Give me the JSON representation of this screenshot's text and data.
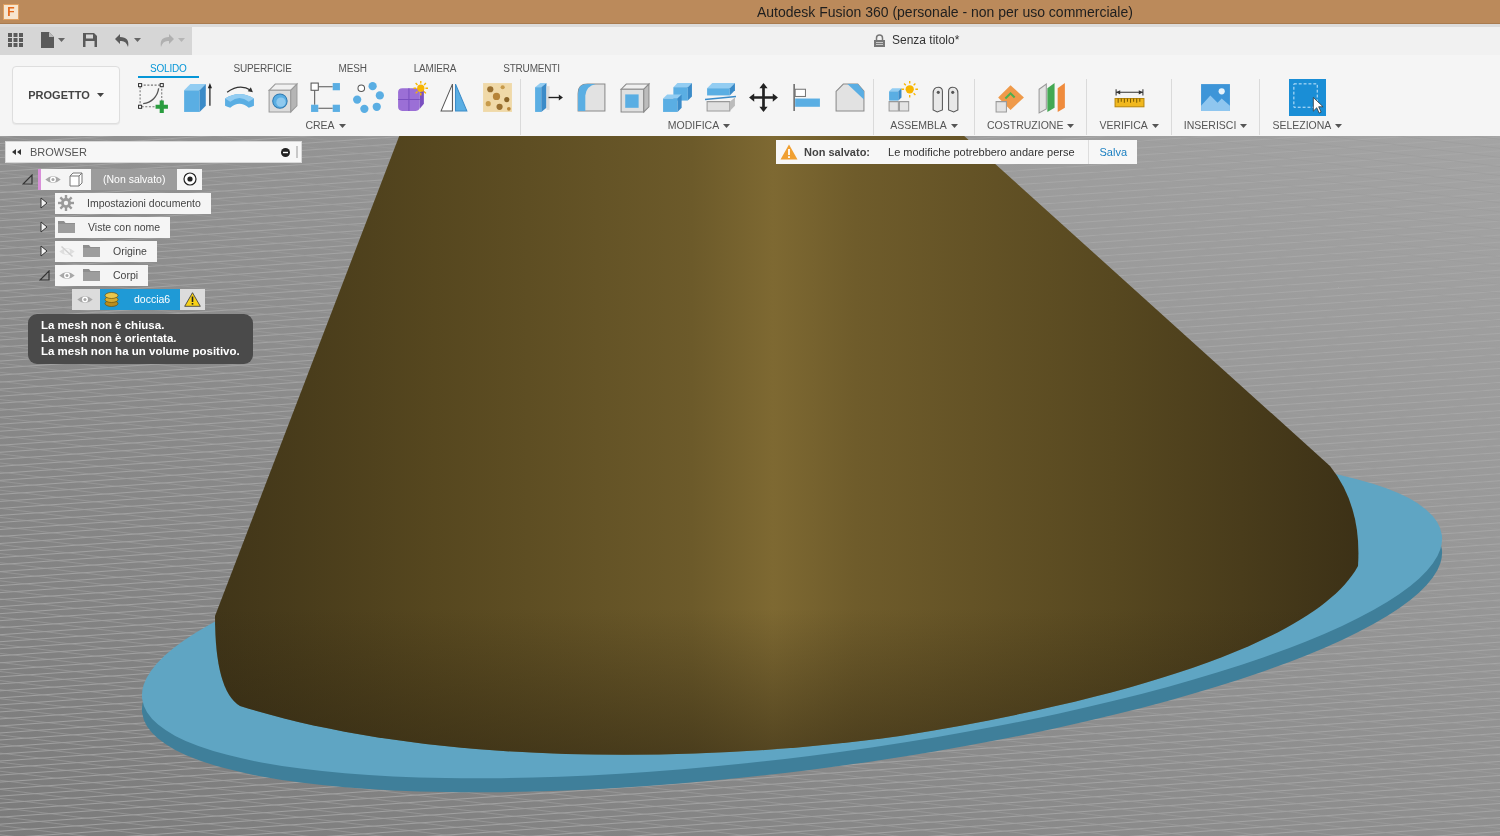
{
  "window": {
    "logo": "F",
    "title": "Autodesk Fusion 360 (personale - non per uso commerciale)"
  },
  "quick_access": [
    {
      "kind": "apps",
      "disabled": false
    },
    {
      "kind": "file",
      "disabled": false
    },
    {
      "kind": "save",
      "disabled": false
    },
    {
      "kind": "undo",
      "disabled": false
    },
    {
      "kind": "redo",
      "disabled": true
    }
  ],
  "document_tab": {
    "title": "Senza titolo*"
  },
  "ribbon": {
    "project_button": "PROGETTO",
    "tabs": [
      {
        "label": "SOLIDO",
        "selected": true
      },
      {
        "label": "SUPERFICIE",
        "selected": false
      },
      {
        "label": "MESH",
        "selected": false
      },
      {
        "label": "LAMIERA",
        "selected": false
      },
      {
        "label": "STRUMENTI",
        "selected": false
      }
    ],
    "groups": [
      {
        "label": "CREA",
        "tools": [
          {
            "kind": "sketch"
          },
          {
            "kind": "extrude"
          },
          {
            "kind": "revolve"
          },
          {
            "kind": "hole"
          },
          {
            "kind": "rectangular-pattern"
          },
          {
            "kind": "circular-pattern"
          },
          {
            "kind": "form"
          },
          {
            "kind": "mirror"
          },
          {
            "kind": "texture"
          }
        ]
      },
      {
        "label": "MODIFICA",
        "tools": [
          {
            "kind": "press-pull"
          },
          {
            "kind": "fillet"
          },
          {
            "kind": "shell"
          },
          {
            "kind": "combine"
          },
          {
            "kind": "split"
          },
          {
            "kind": "move"
          },
          {
            "kind": "align"
          },
          {
            "kind": "chamfer"
          }
        ]
      },
      {
        "label": "ASSEMBLA",
        "tools": [
          {
            "kind": "new-component"
          },
          {
            "kind": "joint"
          }
        ]
      },
      {
        "label": "COSTRUZIONE",
        "tools": [
          {
            "kind": "offset-plane"
          },
          {
            "kind": "midplane"
          }
        ]
      },
      {
        "label": "VERIFICA",
        "tools": [
          {
            "kind": "measure"
          }
        ]
      },
      {
        "label": "INSERISCI",
        "tools": [
          {
            "kind": "insert-image"
          }
        ]
      },
      {
        "label": "SELEZIONA",
        "tools": [
          {
            "kind": "select"
          }
        ]
      }
    ]
  },
  "browser": {
    "title": "BROWSER",
    "tree": [
      {
        "label": "(Non salvato)",
        "kind": "component",
        "visible": true,
        "expanded": true,
        "selected": false,
        "warning": false,
        "children": [
          {
            "label": "Impostazioni documento",
            "kind": "settings",
            "expanded": false,
            "selected": false,
            "warning": false
          },
          {
            "label": "Viste con nome",
            "kind": "folder",
            "expanded": false,
            "selected": false,
            "warning": false
          },
          {
            "label": "Origine",
            "kind": "folder",
            "visible": false,
            "expanded": false,
            "selected": false,
            "warning": false
          },
          {
            "label": "Corpi",
            "kind": "folder",
            "visible": true,
            "expanded": true,
            "selected": false,
            "warning": false,
            "children": [
              {
                "label": "doccia6",
                "kind": "mesh-body",
                "visible": true,
                "selected": true,
                "warning": true
              }
            ]
          }
        ]
      }
    ]
  },
  "tooltip": {
    "lines": [
      "La mesh non è chiusa.",
      "La mesh non è orientata.",
      "La mesh non ha un volume positivo."
    ]
  },
  "notification": {
    "label": "Non salvato:",
    "message": "Le modifiche potrebbero andare perse",
    "action": "Salva"
  }
}
